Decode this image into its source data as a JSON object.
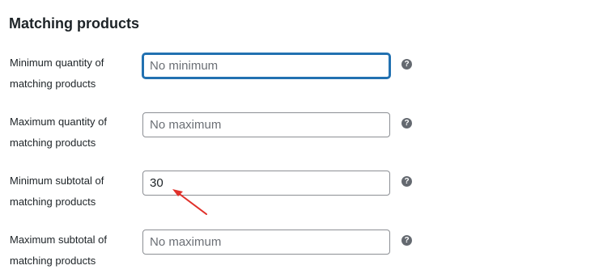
{
  "section": {
    "title": "Matching products"
  },
  "fields": [
    {
      "label": "Minimum quantity of\nmatching products",
      "value": "",
      "placeholder": "No minimum",
      "help_icon": "question-circle-icon"
    },
    {
      "label": "Maximum quantity of\nmatching products",
      "value": "",
      "placeholder": "No maximum",
      "help_icon": "question-circle-icon"
    },
    {
      "label": "Minimum subtotal of\nmatching products",
      "value": "30",
      "placeholder": "",
      "help_icon": "question-circle-icon"
    },
    {
      "label": "Maximum subtotal of\nmatching products",
      "value": "",
      "placeholder": "No maximum",
      "help_icon": "question-circle-icon"
    }
  ],
  "colors": {
    "focus_border": "#2271b1",
    "input_border": "#8c8f94",
    "help_icon": "#646970",
    "annotation_arrow": "#e0302a"
  }
}
